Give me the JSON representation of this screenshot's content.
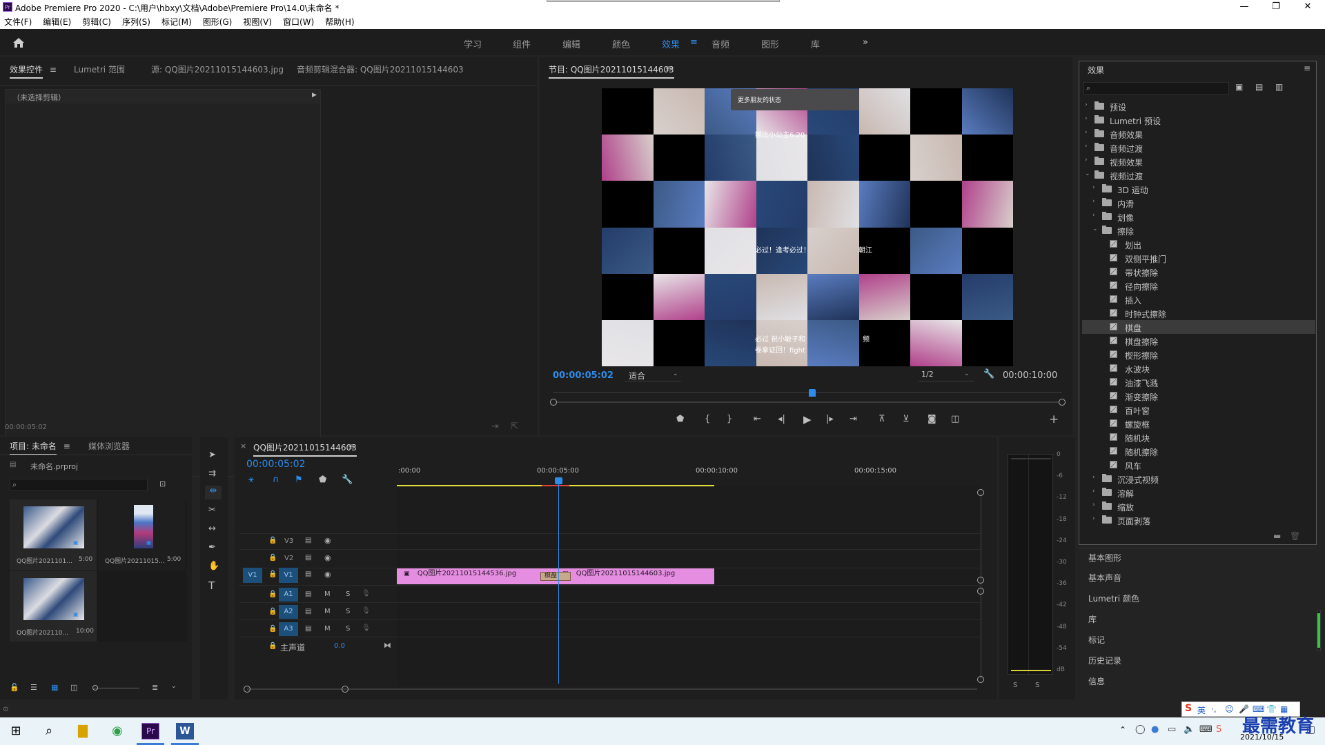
{
  "window": {
    "title": "Adobe Premiere Pro 2020 - C:\\用户\\hbxy\\文档\\Adobe\\Premiere Pro\\14.0\\未命名 *",
    "logo_text": "Pr",
    "minimize": "—",
    "restore": "❐",
    "close": "✕"
  },
  "menu": [
    "文件(F)",
    "编辑(E)",
    "剪辑(C)",
    "序列(S)",
    "标记(M)",
    "图形(G)",
    "视图(V)",
    "窗口(W)",
    "帮助(H)"
  ],
  "workspaces": {
    "tabs": [
      "学习",
      "组件",
      "编辑",
      "颜色",
      "效果",
      "音频",
      "图形",
      "库"
    ],
    "active": "效果",
    "overflow": "»",
    "menu_glyph": "≡"
  },
  "source_panel": {
    "tabs": [
      "效果控件",
      "Lumetri 范围",
      "源: QQ图片20211015144603.jpg",
      "音频剪辑混合器: QQ图片20211015144603"
    ],
    "no_clip": "（未选择剪辑）",
    "timecode": "00:00:05:02"
  },
  "program": {
    "title": "节目: QQ图片20211015144603",
    "timecode": "00:00:05:02",
    "fit": "适合",
    "resolution": "1/2",
    "duration": "00:00:10:00",
    "playhead_fraction": 0.5,
    "overlay_texts": [
      "更多朋友的状态",
      "娜比小公主6.20",
      "必过！逢考必过！",
      "朝江",
      "必过 祝小敏子和",
      "卷拿证回！fight",
      "频"
    ]
  },
  "effects": {
    "title": "效果",
    "search_placeholder": "",
    "items": [
      {
        "label": "预设",
        "level": 0,
        "type": "folder-star",
        "expanded": false
      },
      {
        "label": "Lumetri 预设",
        "level": 0,
        "type": "folder-star",
        "expanded": false
      },
      {
        "label": "音频效果",
        "level": 0,
        "type": "folder",
        "expanded": false
      },
      {
        "label": "音频过渡",
        "level": 0,
        "type": "folder",
        "expanded": false
      },
      {
        "label": "视频效果",
        "level": 0,
        "type": "folder",
        "expanded": false
      },
      {
        "label": "视频过渡",
        "level": 0,
        "type": "folder",
        "expanded": true
      },
      {
        "label": "3D 运动",
        "level": 1,
        "type": "folder",
        "expanded": false
      },
      {
        "label": "内滑",
        "level": 1,
        "type": "folder",
        "expanded": false
      },
      {
        "label": "划像",
        "level": 1,
        "type": "folder",
        "expanded": false
      },
      {
        "label": "擦除",
        "level": 1,
        "type": "folder",
        "expanded": true
      },
      {
        "label": "划出",
        "level": 2,
        "type": "fx"
      },
      {
        "label": "双侧平推门",
        "level": 2,
        "type": "fx"
      },
      {
        "label": "带状擦除",
        "level": 2,
        "type": "fx"
      },
      {
        "label": "径向擦除",
        "level": 2,
        "type": "fx"
      },
      {
        "label": "插入",
        "level": 2,
        "type": "fx"
      },
      {
        "label": "时钟式擦除",
        "level": 2,
        "type": "fx"
      },
      {
        "label": "棋盘",
        "level": 2,
        "type": "fx",
        "selected": true
      },
      {
        "label": "棋盘擦除",
        "level": 2,
        "type": "fx"
      },
      {
        "label": "楔形擦除",
        "level": 2,
        "type": "fx"
      },
      {
        "label": "水波块",
        "level": 2,
        "type": "fx"
      },
      {
        "label": "油漆飞溅",
        "level": 2,
        "type": "fx"
      },
      {
        "label": "渐变擦除",
        "level": 2,
        "type": "fx"
      },
      {
        "label": "百叶窗",
        "level": 2,
        "type": "fx"
      },
      {
        "label": "螺旋框",
        "level": 2,
        "type": "fx"
      },
      {
        "label": "随机块",
        "level": 2,
        "type": "fx"
      },
      {
        "label": "随机擦除",
        "level": 2,
        "type": "fx"
      },
      {
        "label": "风车",
        "level": 2,
        "type": "fx"
      },
      {
        "label": "沉浸式视频",
        "level": 1,
        "type": "folder",
        "expanded": false
      },
      {
        "label": "溶解",
        "level": 1,
        "type": "folder",
        "expanded": false
      },
      {
        "label": "缩放",
        "level": 1,
        "type": "folder",
        "expanded": false
      },
      {
        "label": "页面剥落",
        "level": 1,
        "type": "folder",
        "expanded": false
      }
    ]
  },
  "side_panels": [
    "基本图形",
    "基本声音",
    "Lumetri 颜色",
    "库",
    "标记",
    "历史记录",
    "信息"
  ],
  "project": {
    "tabs": [
      "项目: 未命名",
      "媒体浏览器"
    ],
    "file": "未命名.prproj",
    "items": [
      {
        "name": "QQ图片2021101...",
        "duration": "5:00"
      },
      {
        "name": "QQ图片20211015...",
        "duration": "5:00"
      },
      {
        "name": "QQ图片202110...",
        "duration": "10:00"
      }
    ]
  },
  "timeline": {
    "tab": "QQ图片20211015144603",
    "timecode": "00:00:05:02",
    "ruler": [
      ":00:00",
      "00:00:05:00",
      "00:00:10:00",
      "00:00:15:00"
    ],
    "video_tracks": [
      "V3",
      "V2",
      "V1"
    ],
    "audio_tracks": [
      "A1",
      "A2",
      "A3"
    ],
    "master_label": "主声道",
    "master_value": "0.0",
    "source_patch": "V1",
    "clips": [
      {
        "name": "QQ图片20211015144536.jpg",
        "track": "V1",
        "start": 0,
        "end": 5
      },
      {
        "name": "QQ图片20211015144603.jpg",
        "track": "V1",
        "start": 5,
        "end": 10
      }
    ],
    "transition": "棋盘",
    "playhead_seconds": 5.08,
    "track_buttons": {
      "mute": "M",
      "solo": "S"
    }
  },
  "meter": {
    "scale": [
      "0",
      "-6",
      "-12",
      "-18",
      "-24",
      "-30",
      "-36",
      "-42",
      "-48",
      "-54",
      "dB"
    ],
    "solo": [
      "S",
      "S"
    ]
  },
  "taskbar": {
    "ime": "英",
    "date": "2021/10/15",
    "watermark": "最需教育"
  },
  "colors": {
    "accent": "#2d8ceb",
    "clip": "#e58de0",
    "panel": "#1e1e1e",
    "selected_row": "#3b3b3b"
  }
}
